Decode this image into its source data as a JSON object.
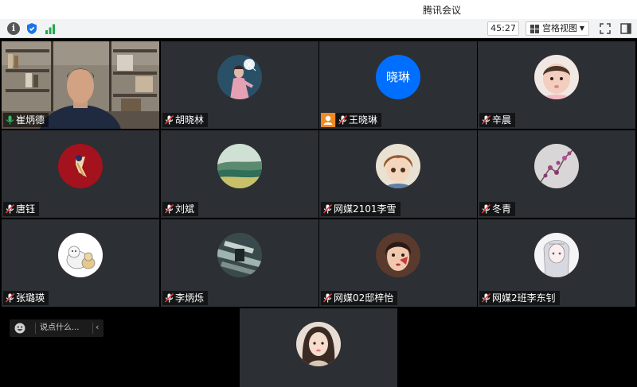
{
  "app": {
    "title": "腾讯会议"
  },
  "toolbar": {
    "info_icon": "info-icon",
    "shield_icon": "shield-icon",
    "signal_icon": "signal-icon",
    "timer": "45:27",
    "view_mode": "宫格视图",
    "fullscreen_icon": "fullscreen-icon",
    "panel_icon": "side-panel-icon"
  },
  "colors": {
    "accent_blue": "#006fff",
    "active_speaker": "#2fbd5f",
    "host_badge": "#f28a22",
    "tile_bg": "#2c2f33"
  },
  "participants": [
    {
      "name": "崔炳德",
      "video": true,
      "speaking": true
    },
    {
      "name": "胡晓林",
      "avatar": "photo-avatar"
    },
    {
      "name": "王晓琳",
      "avatar_text": "晓琳",
      "host": true
    },
    {
      "name": "辛晨",
      "avatar": "photo-avatar"
    },
    {
      "name": "唐钰",
      "avatar": "photo-avatar"
    },
    {
      "name": "刘斌",
      "avatar": "photo-avatar"
    },
    {
      "name": "网媒2101李雪",
      "avatar": "photo-avatar"
    },
    {
      "name": "冬青",
      "avatar": "photo-avatar"
    },
    {
      "name": "张璐瑛",
      "avatar": "photo-avatar"
    },
    {
      "name": "李炳烁",
      "avatar": "photo-avatar"
    },
    {
      "name": "网媒02邸梓怡",
      "avatar": "photo-avatar"
    },
    {
      "name": "网媒2班李东钊",
      "avatar": "photo-avatar"
    },
    {
      "name": "",
      "avatar": "photo-avatar"
    }
  ],
  "chat": {
    "placeholder": "说点什么...",
    "emoji_icon": "emoji-icon",
    "collapse_icon": "chevron-left-icon"
  }
}
